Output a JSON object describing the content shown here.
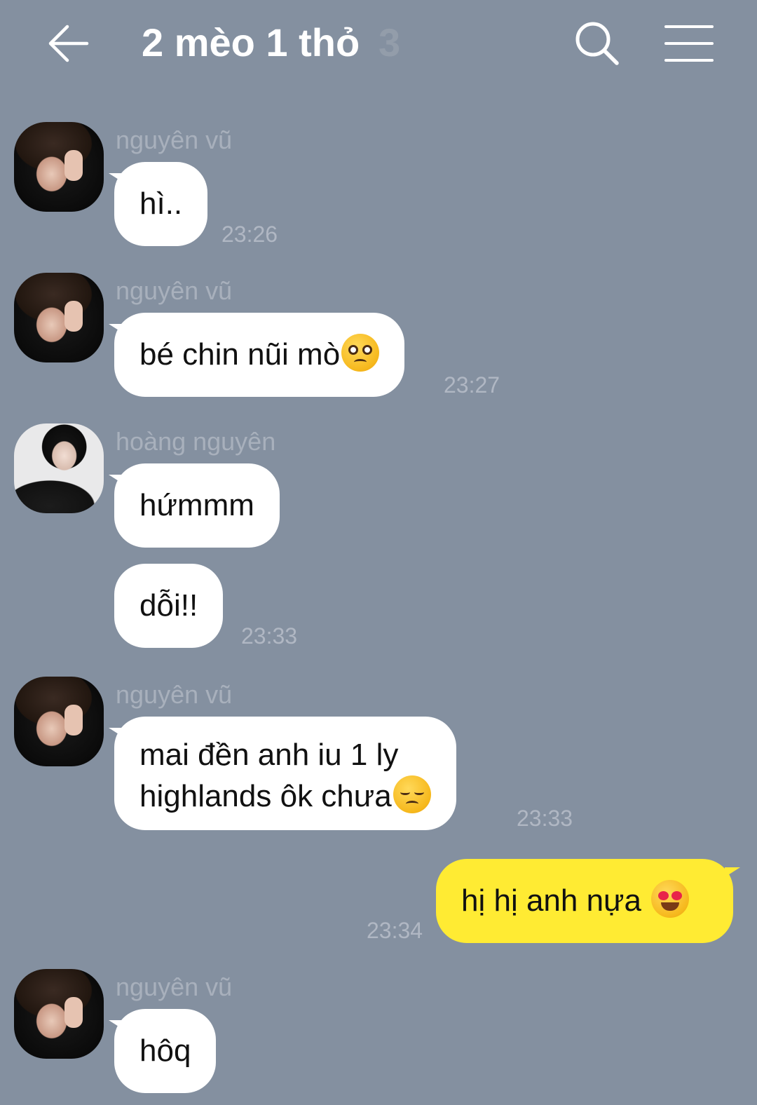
{
  "header": {
    "title": "2 mèo 1 thỏ",
    "member_count": "3"
  },
  "messages": [
    {
      "sender": "nguyên vũ",
      "text": "hì..",
      "time": "23:26"
    },
    {
      "sender": "nguyên vũ",
      "text": "bé chin nũi mò",
      "emoji": "pleading-face",
      "time": "23:27"
    },
    {
      "sender": "hoàng nguyên",
      "text": "hứmmm"
    },
    {
      "text": "dỗi!!",
      "time": "23:33"
    },
    {
      "sender": "nguyên vũ",
      "line1": "mai đền anh iu 1 ly",
      "line2": "highlands ôk chưa",
      "emoji": "disappointed-face",
      "time": "23:33"
    },
    {
      "mine": true,
      "text": "hị hị anh nựa ",
      "emoji": "heart-eyes-face",
      "time": "23:34"
    },
    {
      "sender": "nguyên vũ",
      "text": "hôq"
    }
  ],
  "colors": {
    "background": "#8490a0",
    "my_bubble": "#ffeb33",
    "other_bubble": "#ffffff"
  }
}
